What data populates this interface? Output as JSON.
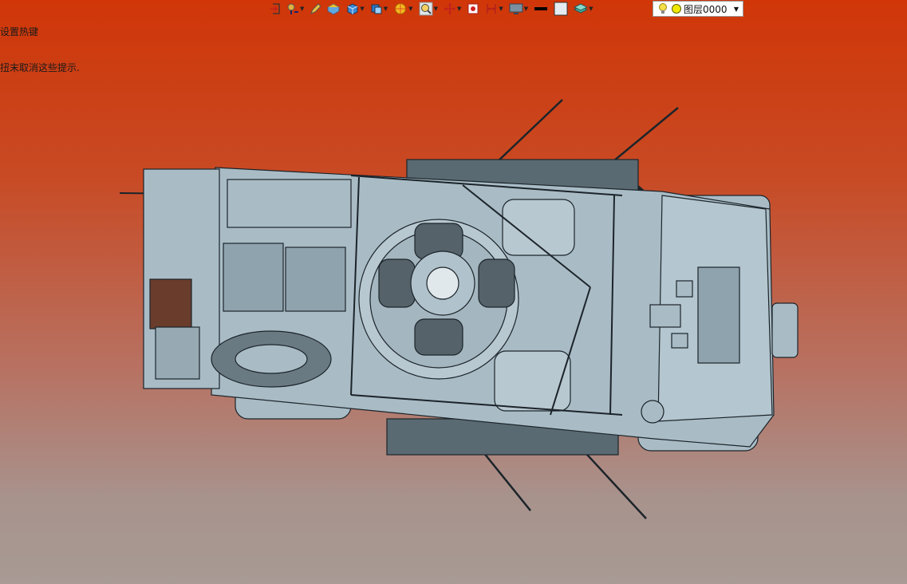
{
  "hint": {
    "line1": "设置热键",
    "line2": "扭末取消这些提示."
  },
  "toolbar": {
    "icons": [
      "exit-icon",
      "snap-icon",
      "pencil-icon",
      "layer-box-icon",
      "solid-cube-icon",
      "view-cube-icon",
      "render-sphere-icon",
      "zoom-icon",
      "pan-icon",
      "section-icon",
      "dimension-icon",
      "display-icon",
      "line-weight-icon",
      "color-icon",
      "layers-stack-icon"
    ]
  },
  "layer": {
    "name": "图层0000",
    "bulb_color": "#f0d020",
    "sun_color": "#f0e800"
  },
  "colors": {
    "model_fill": "#a9bcc6",
    "model_line": "#1c242a",
    "bg_top": "#d03608",
    "bg_bottom": "#a89a94"
  }
}
